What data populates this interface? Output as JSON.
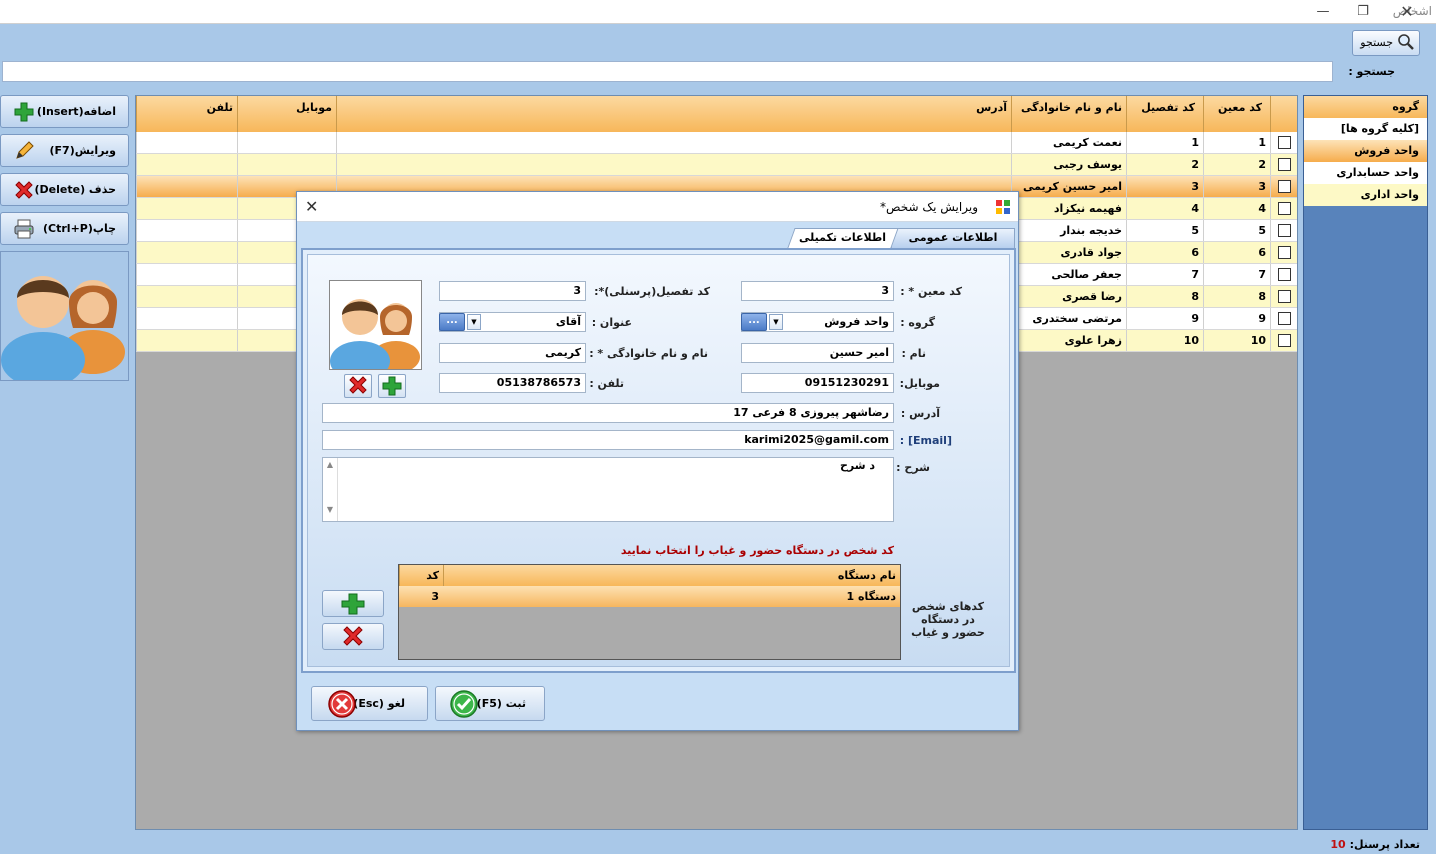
{
  "window": {
    "title": "اشخاص"
  },
  "search": {
    "button_label": "جستجو",
    "label": "جستجو :",
    "value": ""
  },
  "actions": {
    "insert": "اضافه(Insert)",
    "edit": "ویرایش(F7)",
    "delete": "حذف (Delete)",
    "print": "چاپ(Ctrl+P)"
  },
  "grid": {
    "headers": {
      "code": "کد معین",
      "detail": "کد تفصیل",
      "name": "نام و نام خانوادگی",
      "address": "آدرس",
      "mobile": "موبایل",
      "phone": "تلفن"
    },
    "rows": [
      {
        "code": "1",
        "detail": "1",
        "name": "نعمت کریمی"
      },
      {
        "code": "2",
        "detail": "2",
        "name": "یوسف رجبی"
      },
      {
        "code": "3",
        "detail": "3",
        "name": "امیر حسین کریمی"
      },
      {
        "code": "4",
        "detail": "4",
        "name": "فهیمه نیکزاد"
      },
      {
        "code": "5",
        "detail": "5",
        "name": "خدیجه بندار"
      },
      {
        "code": "6",
        "detail": "6",
        "name": "جواد قادری"
      },
      {
        "code": "7",
        "detail": "7",
        "name": "جعفر صالحی"
      },
      {
        "code": "8",
        "detail": "8",
        "name": "رضا قصری"
      },
      {
        "code": "9",
        "detail": "9",
        "name": "مرتضی سختدری"
      },
      {
        "code": "10",
        "detail": "10",
        "name": "زهرا علوی"
      }
    ],
    "selected_index": 2
  },
  "groups": {
    "header": "گروه",
    "items": [
      "[کلیه گروه ها]",
      "واحد فروش",
      "واحد حسابداری",
      "واحد اداری"
    ],
    "selected_index": 1
  },
  "status": {
    "count_label": "تعداد پرسنل:",
    "count_value": "10"
  },
  "dialog": {
    "title": "ویرایش یک شخص*",
    "tabs": [
      "اطلاعات عمومی",
      "اطلاعات تکمیلی"
    ],
    "labels": {
      "code": "کد معین * :",
      "detail": "کد تفصیل(پرسنلی)*:",
      "group": "گروه :",
      "salutation": "عنوان :",
      "first_name": "نام :",
      "full_name": "نام و نام خانوادگی * :",
      "mobile": "موبایل:",
      "phone": "تلفن :",
      "address": "آدرس :",
      "email": "[Email] :",
      "desc": "شرح :",
      "device_note": "کد شخص در دستگاه حضور و غیاب را انتخاب نمایید",
      "device_codes": "کدهای شخص در دستگاه حضور و غیاب"
    },
    "values": {
      "code": "3",
      "detail": "3",
      "group": "واحد فروش",
      "salutation": "آقای",
      "first_name": "امیر حسین",
      "full_name": "کریمی",
      "mobile": "09151230291",
      "phone": "05138786573",
      "address": "رضاشهر پیروزی 8 فرعی 17",
      "email": "karimi2025@gamil.com",
      "desc": "د شرح"
    },
    "dots": "...",
    "devices": {
      "headers": {
        "name": "نام دستگاه",
        "code": "کد"
      },
      "rows": [
        {
          "name": "دستگاه 1",
          "code": "3"
        }
      ]
    },
    "buttons": {
      "save": "ثبت (F5)",
      "cancel": "لغو (Esc)"
    }
  },
  "colors": {
    "accent_orange": "#f7b75a",
    "selected_row": "#f6ac4c",
    "panel_blue": "#5883bb",
    "background": "#a9c8e8"
  }
}
